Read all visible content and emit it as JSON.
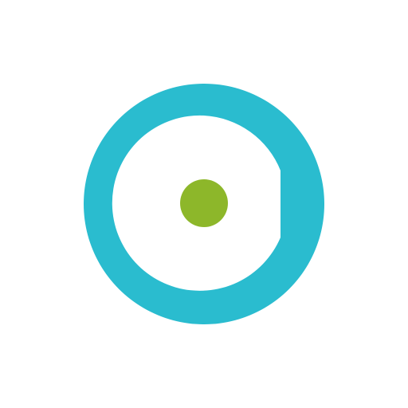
{
  "logo": {
    "icon": "ring-with-dot-logo-icon",
    "colors": {
      "background": "#ffffff",
      "ring": "#2abccf",
      "dot": "#8db72a"
    }
  }
}
